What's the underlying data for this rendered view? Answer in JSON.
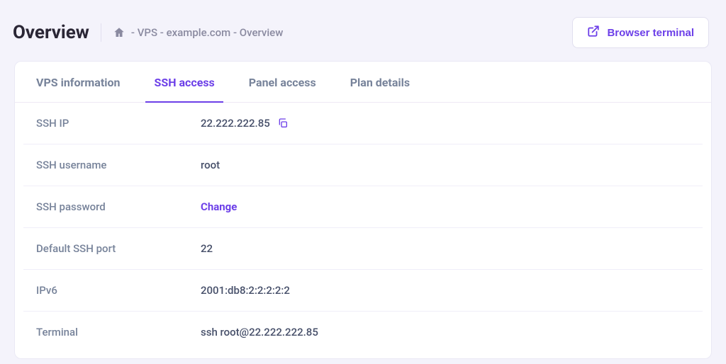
{
  "page": {
    "title": "Overview",
    "breadcrumb": "- VPS - example.com - Overview"
  },
  "actions": {
    "browser_terminal": "Browser terminal"
  },
  "tabs": {
    "vps_info": "VPS information",
    "ssh_access": "SSH access",
    "panel_access": "Panel access",
    "plan_details": "Plan details"
  },
  "ssh": {
    "labels": {
      "ip": "SSH IP",
      "username": "SSH username",
      "password": "SSH password",
      "port": "Default SSH port",
      "ipv6": "IPv6",
      "terminal": "Terminal"
    },
    "values": {
      "ip": "22.222.222.85",
      "username": "root",
      "password_action": "Change",
      "port": "22",
      "ipv6": "2001:db8:2:2:2:2:2",
      "terminal": "ssh root@22.222.222.85"
    }
  },
  "colors": {
    "accent": "#6c3fe8",
    "muted": "#77839a",
    "bg": "#f4f3fb"
  }
}
